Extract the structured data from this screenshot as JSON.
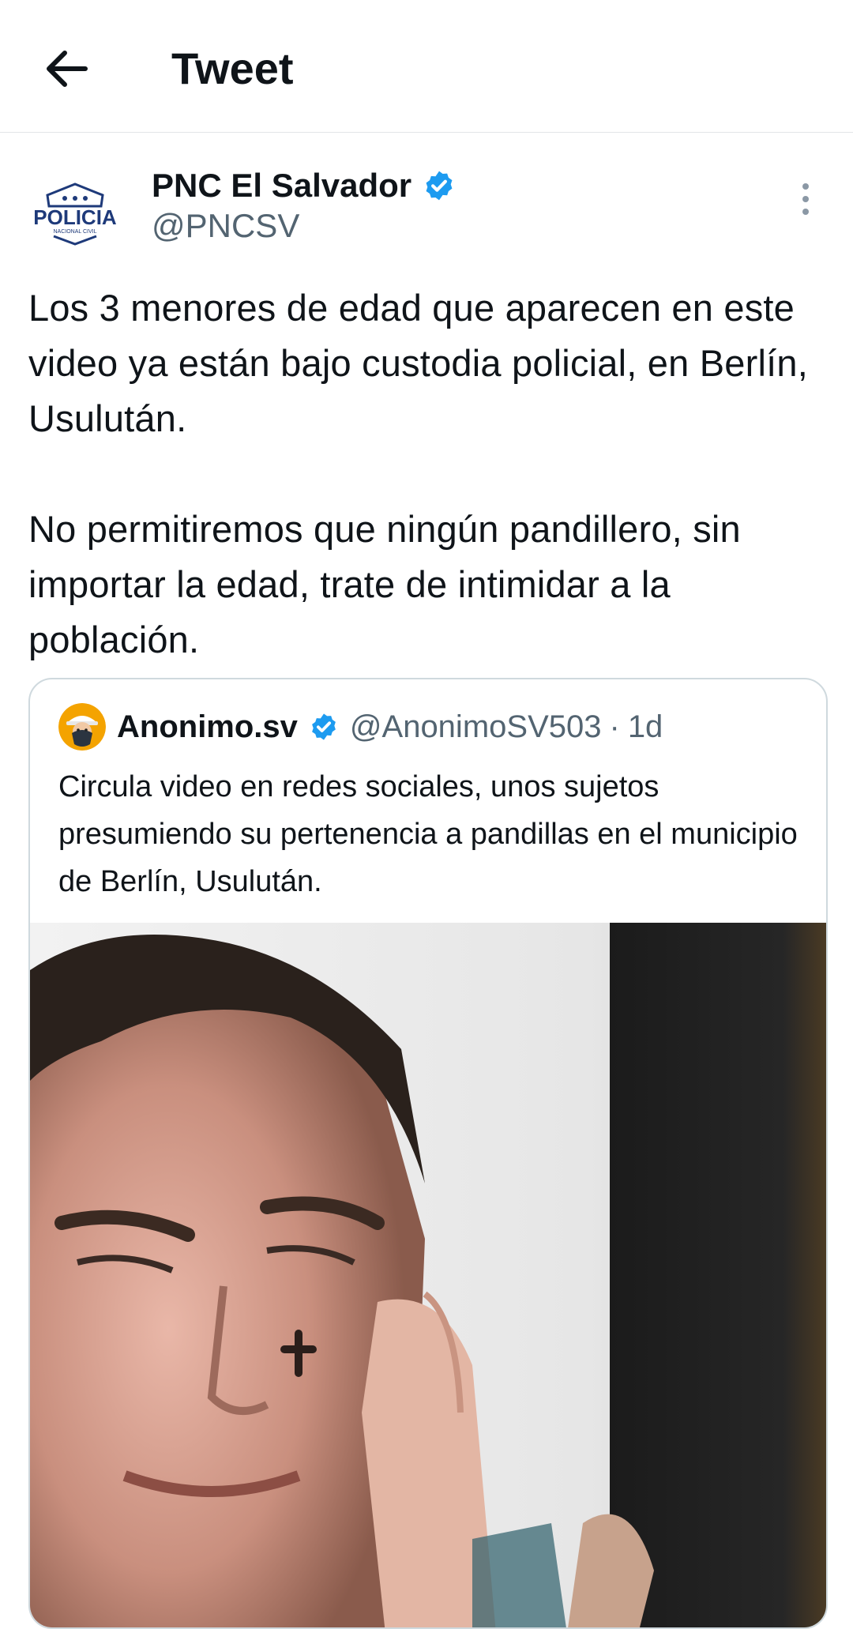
{
  "header": {
    "title": "Tweet",
    "back_icon": "arrow-left-icon"
  },
  "tweet": {
    "author_name": "PNC El Salvador",
    "author_handle": "@PNCSV",
    "avatar_logo_text": "POLICIA",
    "avatar_logo_subtext": "NACIONAL CIVIL",
    "verified": true,
    "text": "Los 3 menores de edad que aparecen en este video ya están bajo custodia policial, en Berlín, Usulután.\n\nNo permitiremos que ningún pandillero, sin importar la edad, trate de intimidar a la población."
  },
  "quoted_tweet": {
    "author_name": "Anonimo.sv",
    "author_handle": "@AnonimoSV503",
    "separator": "·",
    "time": "1d",
    "verified": true,
    "text": "Circula video en redes sociales, unos sujetos presumiendo su pertenencia a pandillas en el municipio de Berlín, Usulután."
  },
  "colors": {
    "verified_blue": "#1d9bf0",
    "secondary_text": "#536471",
    "border": "#cfd9de"
  }
}
